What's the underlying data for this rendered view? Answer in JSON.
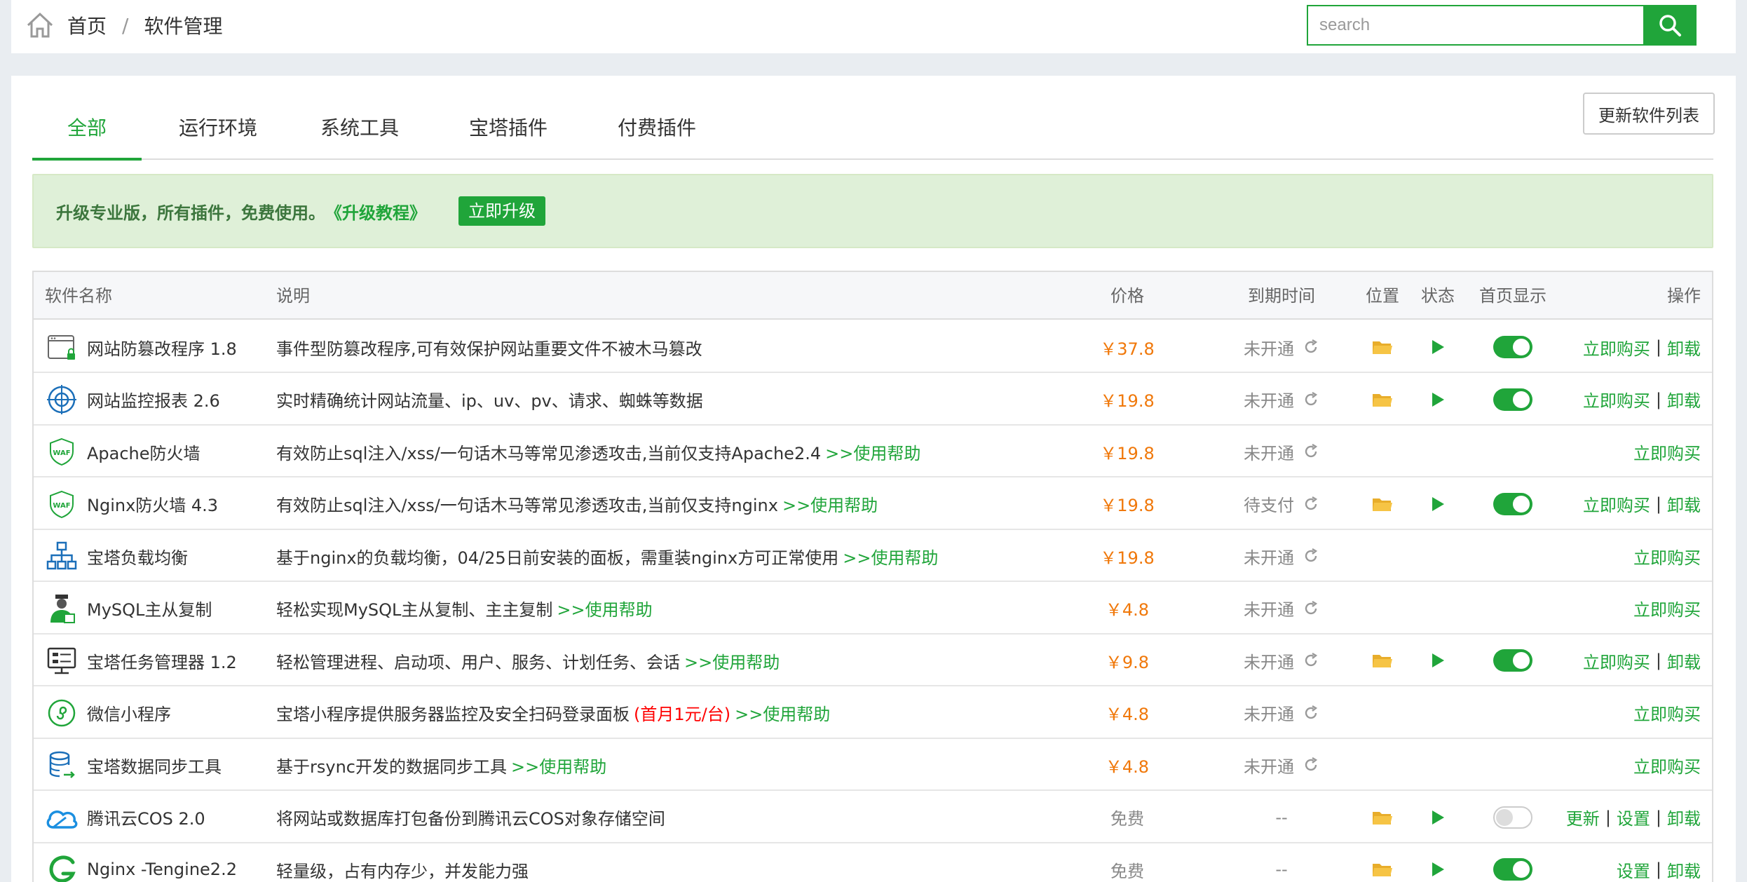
{
  "breadcrumb": {
    "home": "首页",
    "separator": "/",
    "current": "软件管理"
  },
  "search": {
    "placeholder": "search"
  },
  "tabs": [
    {
      "label": "全部",
      "active": true
    },
    {
      "label": "运行环境",
      "active": false
    },
    {
      "label": "系统工具",
      "active": false
    },
    {
      "label": "宝塔插件",
      "active": false
    },
    {
      "label": "付费插件",
      "active": false
    }
  ],
  "update_button": "更新软件列表",
  "notice": {
    "text": "升级专业版，所有插件，免费使用。",
    "link": "《升级教程》",
    "button": "立即升级"
  },
  "table": {
    "headers": {
      "name": "软件名称",
      "desc": "说明",
      "price": "价格",
      "expire": "到期时间",
      "position": "位置",
      "status": "状态",
      "home": "首页显示",
      "ops": "操作"
    },
    "rows": [
      {
        "icon": "tamper-proof-icon",
        "name": "网站防篡改程序 1.8",
        "desc": "事件型防篡改程序,可有效保护网站重要文件不被木马篡改",
        "help": "",
        "promo": "",
        "price": "￥37.8",
        "expire": "未开通",
        "position": true,
        "status": true,
        "home": "on",
        "ops": [
          "立即购买",
          "卸载"
        ]
      },
      {
        "icon": "monitor-report-icon",
        "name": "网站监控报表 2.6",
        "desc": "实时精确统计网站流量、ip、uv、pv、请求、蜘蛛等数据",
        "help": "",
        "promo": "",
        "price": "￥19.8",
        "expire": "未开通",
        "position": true,
        "status": true,
        "home": "on",
        "ops": [
          "立即购买",
          "卸载"
        ]
      },
      {
        "icon": "waf-shield-icon",
        "name": "Apache防火墙",
        "desc": "有效防止sql注入/xss/一句话木马等常见渗透攻击,当前仅支持Apache2.4",
        "help": ">>使用帮助",
        "promo": "",
        "price": "￥19.8",
        "expire": "未开通",
        "position": false,
        "status": false,
        "home": "",
        "ops": [
          "立即购买"
        ]
      },
      {
        "icon": "waf-shield-icon",
        "name": "Nginx防火墙 4.3",
        "desc": "有效防止sql注入/xss/一句话木马等常见渗透攻击,当前仅支持nginx",
        "help": ">>使用帮助",
        "promo": "",
        "price": "￥19.8",
        "expire": "待支付",
        "position": true,
        "status": true,
        "home": "on",
        "ops": [
          "立即购买",
          "卸载"
        ]
      },
      {
        "icon": "load-balance-icon",
        "name": "宝塔负载均衡",
        "desc": "基于nginx的负载均衡，04/25日前安装的面板，需重装nginx方可正常使用",
        "help": ">>使用帮助",
        "promo": "",
        "price": "￥19.8",
        "expire": "未开通",
        "position": false,
        "status": false,
        "home": "",
        "ops": [
          "立即购买"
        ]
      },
      {
        "icon": "mysql-replication-icon",
        "name": "MySQL主从复制",
        "desc": "轻松实现MySQL主从复制、主主复制",
        "help": ">>使用帮助",
        "promo": "",
        "price": "￥4.8",
        "expire": "未开通",
        "position": false,
        "status": false,
        "home": "",
        "ops": [
          "立即购买"
        ]
      },
      {
        "icon": "task-manager-icon",
        "name": "宝塔任务管理器 1.2",
        "desc": "轻松管理进程、启动项、用户、服务、计划任务、会话",
        "help": ">>使用帮助",
        "promo": "",
        "price": "￥9.8",
        "expire": "未开通",
        "position": true,
        "status": true,
        "home": "on",
        "ops": [
          "立即购买",
          "卸载"
        ]
      },
      {
        "icon": "mini-program-icon",
        "name": "微信小程序",
        "desc": "宝塔小程序提供服务器监控及安全扫码登录面板",
        "help": ">>使用帮助",
        "promo": "(首月1元/台)",
        "price": "￥4.8",
        "expire": "未开通",
        "position": false,
        "status": false,
        "home": "",
        "ops": [
          "立即购买"
        ]
      },
      {
        "icon": "data-sync-icon",
        "name": "宝塔数据同步工具",
        "desc": "基于rsync开发的数据同步工具",
        "help": ">>使用帮助",
        "promo": "",
        "price": "￥4.8",
        "expire": "未开通",
        "position": false,
        "status": false,
        "home": "",
        "ops": [
          "立即购买"
        ]
      },
      {
        "icon": "tencent-cloud-icon",
        "name": "腾讯云COS 2.0",
        "desc": "将网站或数据库打包备份到腾讯云COS对象存储空间",
        "help": "",
        "promo": "",
        "price": "免费",
        "expire": "--",
        "position": true,
        "status": true,
        "home": "off",
        "ops": [
          "更新",
          "设置",
          "卸载"
        ]
      },
      {
        "icon": "tengine-icon",
        "name": "Nginx -Tengine2.2",
        "desc": "轻量级，占有内存少，并发能力强",
        "help": "",
        "promo": "",
        "price": "免费",
        "expire": "--",
        "position": true,
        "status": true,
        "home": "on",
        "ops": [
          "设置",
          "卸载"
        ]
      }
    ]
  },
  "colors": {
    "accent": "#20a53a",
    "price": "#f0780a",
    "promo": "#ff0000",
    "folder": "#f6c445"
  }
}
